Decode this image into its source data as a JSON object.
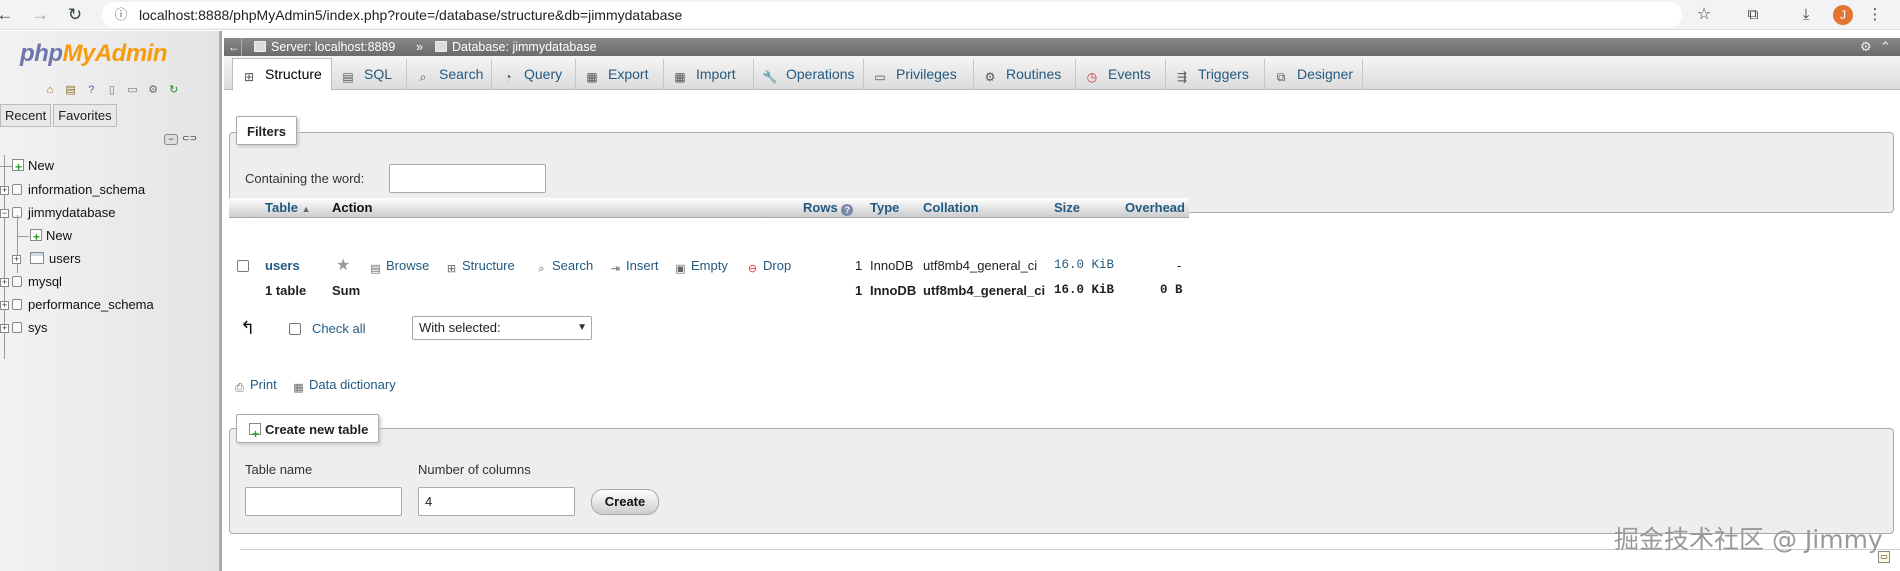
{
  "browser": {
    "url": "localhost:8888/phpMyAdmin5/index.php?route=/database/structure&db=jimmydatabase",
    "profile_initial": "J"
  },
  "logo": {
    "part1": "php",
    "part2": "MyAdmin"
  },
  "panel_tabs": {
    "recent": "Recent",
    "favorites": "Favorites"
  },
  "tree": {
    "new_label": "New",
    "databases": [
      "information_schema",
      "jimmydatabase",
      "mysql",
      "performance_schema",
      "sys"
    ],
    "jimmy_new": "New",
    "jimmy_table": "users"
  },
  "breadcrumb": {
    "server": "Server: localhost:8889",
    "database": "Database: jimmydatabase"
  },
  "tabs": [
    "Structure",
    "SQL",
    "Search",
    "Query",
    "Export",
    "Import",
    "Operations",
    "Privileges",
    "Routines",
    "Events",
    "Triggers",
    "Designer"
  ],
  "filters": {
    "legend": "Filters",
    "label": "Containing the word:",
    "value": ""
  },
  "table": {
    "headers": {
      "table": "Table",
      "action": "Action",
      "rows": "Rows",
      "type": "Type",
      "collation": "Collation",
      "size": "Size",
      "overhead": "Overhead"
    },
    "actions": [
      "Browse",
      "Structure",
      "Search",
      "Insert",
      "Empty",
      "Drop"
    ],
    "rows": [
      {
        "name": "users",
        "rows": "1",
        "type": "InnoDB",
        "collation": "utf8mb4_general_ci",
        "size": "16.0 KiB",
        "overhead": "-"
      }
    ],
    "summary": {
      "name": "1 table",
      "action": "Sum",
      "rows": "1",
      "type": "InnoDB",
      "collation": "utf8mb4_general_ci",
      "size": "16.0 KiB",
      "overhead": "0 B"
    }
  },
  "bulk": {
    "check_all": "Check all",
    "with_selected": "With selected:"
  },
  "links": {
    "print": "Print",
    "data_dictionary": "Data dictionary"
  },
  "create_table": {
    "legend": "Create new table",
    "name_label": "Table name",
    "name_value": "",
    "columns_label": "Number of columns",
    "columns_value": "4",
    "button": "Create"
  },
  "watermark": "掘金技术社区 @ Jimmy",
  "colors": {
    "link": "#235a81",
    "logo_php": "#6c78af",
    "logo_admin": "#f89c0e",
    "drop_icon": "#d33"
  }
}
